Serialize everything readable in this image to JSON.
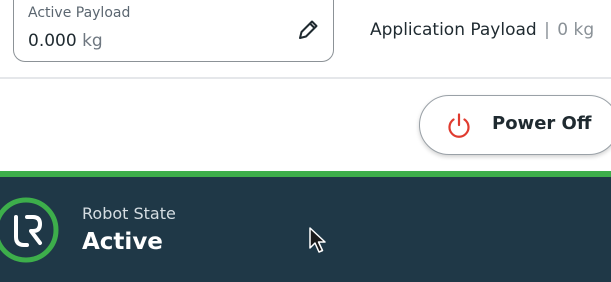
{
  "payload": {
    "active_label": "Active Payload",
    "active_value": "0.000",
    "active_unit": "kg",
    "edit_icon": "pencil-icon",
    "application_label": "Application Payload",
    "application_separator": "|",
    "application_value": "0 kg"
  },
  "power": {
    "label": "Power Off",
    "icon": "power-icon",
    "icon_color": "#e03b2f"
  },
  "robot_state": {
    "label": "Robot State",
    "value": "Active",
    "logo_icon": "ur-logo-icon",
    "accent_color": "#3dae4b",
    "background_color": "#1f3847"
  }
}
